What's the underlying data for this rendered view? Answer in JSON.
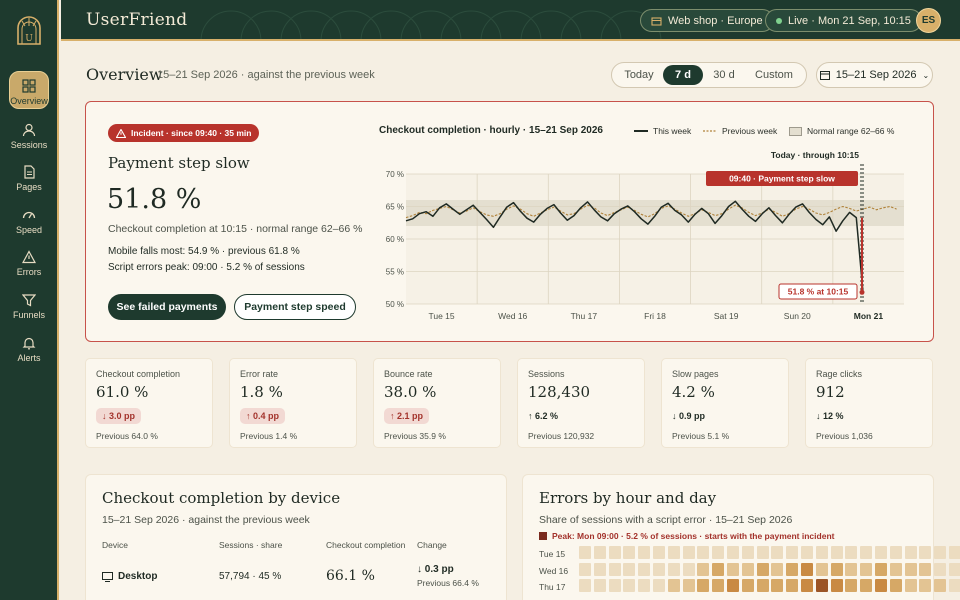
{
  "app": {
    "title": "UserFriend",
    "workspace": "Web shop · Europe",
    "live": "Live · Mon 21 Sep, 10:15",
    "user_initials": "ES"
  },
  "sidebar": {
    "items": [
      {
        "label": "Overview",
        "icon": "grid-icon"
      },
      {
        "label": "Sessions",
        "icon": "user-icon"
      },
      {
        "label": "Pages",
        "icon": "document-icon"
      },
      {
        "label": "Speed",
        "icon": "gauge-icon"
      },
      {
        "label": "Errors",
        "icon": "warning-icon"
      },
      {
        "label": "Funnels",
        "icon": "funnel-icon"
      },
      {
        "label": "Alerts",
        "icon": "bell-icon"
      }
    ]
  },
  "overview": {
    "title": "Overview",
    "subtitle": "15–21 Sep 2026 · against the previous week",
    "ranges": [
      "Today",
      "7 d",
      "30 d",
      "Custom"
    ],
    "active_range": "7 d",
    "date_range": "15–21 Sep 2026"
  },
  "incident": {
    "badge": "Incident · since 09:40 · 35 min",
    "title": "Payment step slow",
    "value": "51.8 %",
    "subtitle": "Checkout completion at 10:15 · normal range 62–66 %",
    "line1": "Mobile falls most: 54.9 % · previous 61.8 %",
    "line2": "Script errors peak: 09:00 · 5.2 % of sessions",
    "primary_button": "See failed payments",
    "secondary_button": "Payment step speed",
    "chart_title": "Checkout completion · hourly · 15–21 Sep 2026",
    "legend_this": "This week",
    "legend_prev": "Previous week",
    "legend_range": "Normal range 62–66 %",
    "today_label": "Today · through 10:15",
    "event_label": "09:40 · Payment step slow",
    "point_label": "51.8 % at 10:15",
    "accent": "#b8332c"
  },
  "chart_data": {
    "type": "line",
    "title": "Checkout completion · hourly · 15–21 Sep 2026",
    "x_ticks": [
      "Tue 15",
      "Wed 16",
      "Thu 17",
      "Fri 18",
      "Sat 19",
      "Sun 20",
      "Mon 21"
    ],
    "y_ticks": [
      "70 %",
      "65 %",
      "60 %",
      "55 %",
      "50 %"
    ],
    "ylim": [
      50,
      70
    ],
    "normal_range": [
      62,
      66
    ],
    "series": [
      {
        "name": "This week",
        "values": [
          62.8,
          63.1,
          63.9,
          64.2,
          63.5,
          64.8,
          65.4,
          64.6,
          63.8,
          64.5,
          65.2,
          64.1,
          63.0,
          61.8,
          63.4,
          64.9,
          65.6,
          64.3,
          63.2,
          62.6,
          63.8,
          64.7,
          65.3,
          64.0,
          62.9,
          63.6,
          64.8,
          65.7,
          64.5,
          63.4,
          62.8,
          63.9,
          64.6,
          65.1,
          64.2,
          63.1,
          62.3,
          63.5,
          64.9,
          65.5,
          64.4,
          63.7,
          62.6,
          63.8,
          64.7,
          63.9,
          62.4,
          63.6,
          65.0,
          65.8,
          64.6,
          63.5,
          62.7,
          63.9,
          64.8,
          63.6,
          62.5,
          63.8,
          64.9,
          65.4,
          64.1,
          63.0,
          62.2,
          63.4,
          61.2,
          62.8,
          64.1,
          63.3,
          51.8
        ]
      },
      {
        "name": "Previous week",
        "values": [
          63.3,
          63.6,
          64.1,
          63.9,
          64.4,
          64.7,
          65.0,
          64.5,
          64.0,
          64.3,
          64.8,
          64.2,
          63.7,
          63.5,
          63.9,
          64.6,
          65.1,
          64.6,
          63.9,
          63.5,
          64.0,
          64.5,
          64.9,
          64.3,
          63.7,
          63.9,
          64.6,
          65.2,
          64.8,
          64.0,
          63.6,
          64.1,
          64.5,
          64.9,
          64.4,
          63.8,
          63.4,
          63.9,
          64.7,
          65.1,
          64.6,
          64.0,
          63.5,
          63.9,
          64.5,
          64.1,
          63.6,
          63.9,
          64.6,
          65.2,
          64.8,
          64.1,
          63.6,
          64.0,
          64.6,
          64.1,
          63.5,
          63.9,
          64.6,
          65.0,
          64.6,
          64.0,
          63.7,
          64.1,
          64.6,
          65.0,
          64.7,
          64.3,
          64.6
        ]
      }
    ]
  },
  "kpis": [
    {
      "label": "Checkout completion",
      "value": "61.0 %",
      "change": "↓ 3.0 pp",
      "kind": "down",
      "previous": "Previous 64.0 %"
    },
    {
      "label": "Error rate",
      "value": "1.8 %",
      "change": "↑ 0.4 pp",
      "kind": "up",
      "previous": "Previous 1.4 %"
    },
    {
      "label": "Bounce rate",
      "value": "38.0 %",
      "change": "↑ 2.1 pp",
      "kind": "up",
      "previous": "Previous 35.9 %"
    },
    {
      "label": "Sessions",
      "value": "128,430",
      "change": "↑ 6.2 %",
      "kind": "neutral",
      "previous": "Previous 120,932"
    },
    {
      "label": "Slow pages",
      "value": "4.2 %",
      "change": "↓ 0.9 pp",
      "kind": "neutral",
      "previous": "Previous 5.1 %"
    },
    {
      "label": "Rage clicks",
      "value": "912",
      "change": "↓ 12 %",
      "kind": "neutral",
      "previous": "Previous 1,036"
    }
  ],
  "device_panel": {
    "title": "Checkout completion by device",
    "subtitle": "15–21 Sep 2026 · against the previous week",
    "headers": [
      "Device",
      "Sessions · share",
      "Checkout completion",
      "Change"
    ],
    "rows": [
      {
        "device": "Desktop",
        "sessions": "57,794 · 45 %",
        "completion": "66.1 %",
        "change": "↓ 0.3 pp",
        "previous": "Previous 66.4 %"
      }
    ]
  },
  "errors_panel": {
    "title": "Errors by hour and day",
    "subtitle": "Share of sessions with a script error · 15–21 Sep 2026",
    "legend": "Peak: Mon 09:00 · 5.2 % of sessions · starts with the payment incident",
    "rows": [
      "Tue 15",
      "Wed 16",
      "Thu 17"
    ],
    "levels": [
      [
        1,
        1,
        1,
        1,
        1,
        1,
        1,
        1,
        1,
        1,
        1,
        1,
        1,
        1,
        1,
        1,
        1,
        1,
        1,
        1,
        1,
        1,
        1,
        1,
        1,
        1,
        1,
        1
      ],
      [
        1,
        1,
        1,
        1,
        1,
        1,
        1,
        1,
        2,
        3,
        2,
        2,
        3,
        2,
        3,
        4,
        2,
        3,
        2,
        2,
        3,
        2,
        2,
        2,
        1,
        1,
        1,
        1
      ],
      [
        1,
        1,
        1,
        1,
        1,
        1,
        2,
        2,
        3,
        3,
        4,
        3,
        3,
        3,
        3,
        4,
        5,
        4,
        3,
        3,
        4,
        3,
        2,
        2,
        2,
        1,
        1,
        1
      ]
    ]
  }
}
